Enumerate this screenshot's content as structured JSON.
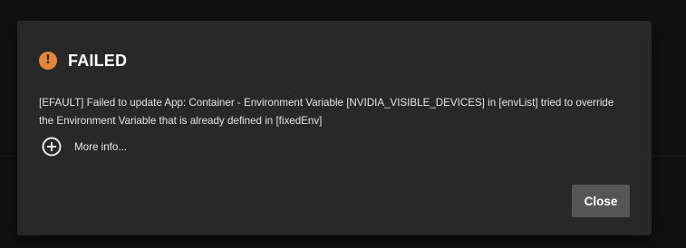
{
  "dialog": {
    "status_icon_glyph": "!",
    "status_icon_name": "warning-icon",
    "status_color": "#e5873a",
    "title": "FAILED",
    "message": "[EFAULT] Failed to update App: Container - Environment Variable [NVIDIA_VISIBLE_DEVICES] in [envList] tried to override the Environment Variable that is already defined in [fixedEnv]",
    "more_info_icon_name": "expand-plus-icon",
    "more_info_label": "More info...",
    "close_label": "Close"
  }
}
